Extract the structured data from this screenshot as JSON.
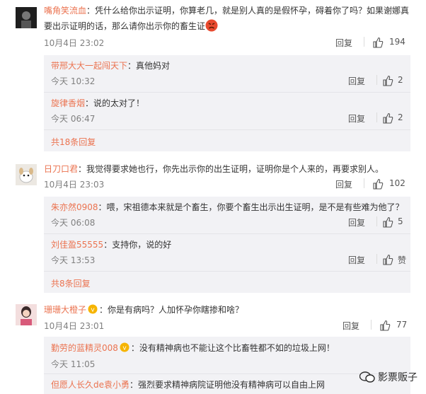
{
  "comments": [
    {
      "user": "嘴角笑流血",
      "text": "：凭什么给你出示证明，你算老几，就是别人真的是假怀孕，碍着你了吗？如果谢娜真要出示证明的话，那么请你出示你的畜生证",
      "time": "10月4日 23:02",
      "reply_label": "回复",
      "likes": "194",
      "replies": [
        {
          "user": "带邢大大一起闯天下",
          "text": "：真他妈对",
          "time": "今天 10:32",
          "reply_label": "回复",
          "likes": "2"
        },
        {
          "user": "旋律香烟",
          "text": "：说的太对了！",
          "time": "今天 06:47",
          "reply_label": "回复",
          "likes": "2"
        }
      ],
      "more_replies": "共18条回复"
    },
    {
      "user": "日刀口君",
      "text": "：我觉得要求她也行，你先出示你的出生证明，证明你是个人来的，再要求别人。",
      "time": "10月4日 23:03",
      "reply_label": "回复",
      "likes": "102",
      "replies": [
        {
          "user": "朱亦然0908",
          "text": "：喂，宋祖德本来就是个畜生，你要个畜生出示出生证明，是不是有些难为他了？",
          "time": "今天 06:08",
          "reply_label": "回复",
          "likes": "5"
        },
        {
          "user": "刘佳盈55555",
          "text": "：支持你，说的好",
          "time": "今天 13:53",
          "reply_label": "回复",
          "likes": "赞"
        }
      ],
      "more_replies": "共8条回复"
    },
    {
      "user": "珊珊大橙子",
      "text": "：你是有病吗？人加怀孕你瞎掺和啥？",
      "time": "10月4日 23:01",
      "reply_label": "回复",
      "likes": "77",
      "replies": [
        {
          "user": "勤劳的蓝精灵008",
          "text": "：没有精神病也不能让这个比畜牲都不如的垃圾上网！",
          "time": "今天 11:05",
          "reply_label": "回复",
          "likes": ""
        },
        {
          "user": "但愿人长久de袁小勇",
          "text": "：强烈要求精神病院证明他没有精神病可以自由上网",
          "time": "",
          "reply_label": "",
          "likes": ""
        }
      ]
    }
  ],
  "watermark": "影票贩子",
  "colors": {
    "username": "#eb7350",
    "reply_bg": "#f2f2f5",
    "time": "#808080"
  }
}
